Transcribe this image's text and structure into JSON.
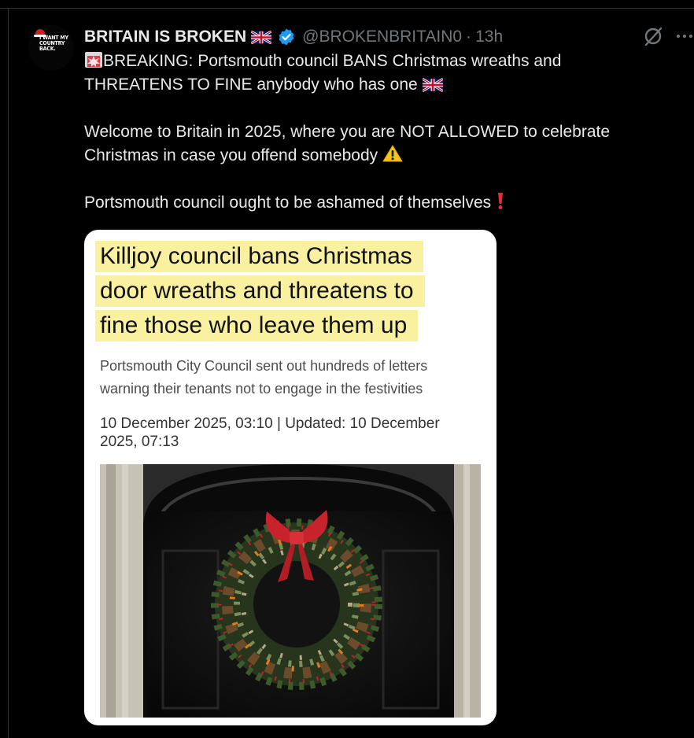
{
  "tweet": {
    "display_name": "BRITAIN IS BROKEN",
    "handle": "@BROKENBRITAIN0",
    "separator": "·",
    "time": "13h",
    "avatar_text": "I WANT MY COUNTRY BACK.",
    "lines": [
      "BREAKING: Portsmouth council BANS Christmas wreaths and",
      "THREATENS TO FINE anybody who has one",
      "Welcome to Britain in 2025, where you are NOT ALLOWED to celebrate",
      "Christmas in case you offend somebody",
      "Portsmouth council ought to be ashamed of themselves"
    ]
  },
  "card": {
    "headline_lines": [
      "Killjoy council bans Christmas",
      "door wreaths and threatens to",
      "fine those who leave them up"
    ],
    "subhead_lines": [
      "Portsmouth City Council sent out hundreds of letters",
      "warning their tenants not to engage in the festivities"
    ],
    "dateline_lines": [
      "10 December 2025, 03:10 | Updated: 10 December",
      "2025, 07:13"
    ]
  },
  "icons": {
    "siren": "police-light-emoji",
    "flag": "union-jack-emoji",
    "warning": "warning-emoji",
    "exclamation": "red-exclamation-emoji",
    "verified": "verified-badge",
    "grok": "grok-icon",
    "more": "more-icon"
  },
  "colors": {
    "background": "#000000",
    "text": "#e7e9ea",
    "muted": "#71767b",
    "verified": "#1d9bf0",
    "highlight": "#f9f0a0"
  }
}
